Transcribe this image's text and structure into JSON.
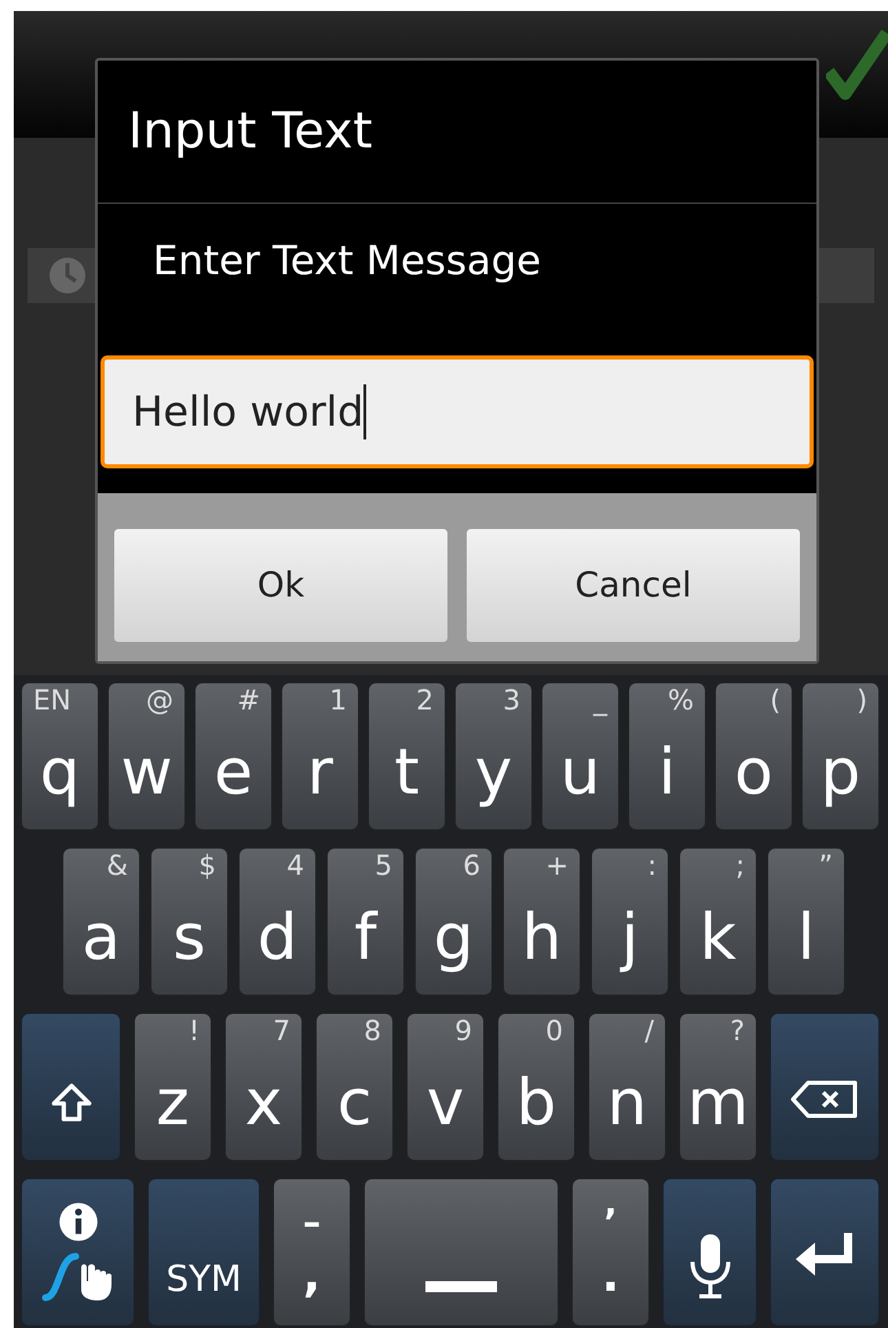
{
  "dialog": {
    "title": "Input Text",
    "message": "Enter Text Message",
    "input": {
      "value": "Hello world",
      "focused": true
    },
    "buttons": [
      "Ok",
      "Cancel"
    ]
  },
  "keyboard": {
    "rows": [
      [
        {
          "kind": "language",
          "main": "q",
          "alt": "EN"
        },
        {
          "kind": "letter",
          "main": "w",
          "alt": "@"
        },
        {
          "kind": "letter",
          "main": "e",
          "alt": "#"
        },
        {
          "kind": "letter",
          "main": "r",
          "alt": "1"
        },
        {
          "kind": "letter",
          "main": "t",
          "alt": "2"
        },
        {
          "kind": "letter",
          "main": "y",
          "alt": "3"
        },
        {
          "kind": "letter",
          "main": "u",
          "alt": "_"
        },
        {
          "kind": "letter",
          "main": "i",
          "alt": "%"
        },
        {
          "kind": "letter",
          "main": "o",
          "alt": "("
        },
        {
          "kind": "letter",
          "main": "p",
          "alt": ")"
        }
      ],
      [
        {
          "kind": "letter",
          "main": "a",
          "alt": "&"
        },
        {
          "kind": "letter",
          "main": "s",
          "alt": "$"
        },
        {
          "kind": "letter",
          "main": "d",
          "alt": "4"
        },
        {
          "kind": "letter",
          "main": "f",
          "alt": "5"
        },
        {
          "kind": "letter",
          "main": "g",
          "alt": "6"
        },
        {
          "kind": "letter",
          "main": "h",
          "alt": "+"
        },
        {
          "kind": "letter",
          "main": "j",
          "alt": ":"
        },
        {
          "kind": "letter",
          "main": "k",
          "alt": ";"
        },
        {
          "kind": "letter",
          "main": "l",
          "alt": "”"
        }
      ],
      [
        {
          "kind": "shift"
        },
        {
          "kind": "letter",
          "main": "z",
          "alt": "!"
        },
        {
          "kind": "letter",
          "main": "x",
          "alt": "7"
        },
        {
          "kind": "letter",
          "main": "c",
          "alt": "8"
        },
        {
          "kind": "letter",
          "main": "v",
          "alt": "9"
        },
        {
          "kind": "letter",
          "main": "b",
          "alt": "0"
        },
        {
          "kind": "letter",
          "main": "n",
          "alt": "/"
        },
        {
          "kind": "letter",
          "main": "m",
          "alt": "?"
        },
        {
          "kind": "delete"
        }
      ],
      [
        {
          "kind": "swype"
        },
        {
          "kind": "sym",
          "main": "SYM"
        },
        {
          "kind": "punct",
          "main": ",",
          "alt": "–"
        },
        {
          "kind": "space"
        },
        {
          "kind": "punct",
          "main": ".",
          "alt": "’"
        },
        {
          "kind": "mic"
        },
        {
          "kind": "enter"
        }
      ]
    ]
  }
}
